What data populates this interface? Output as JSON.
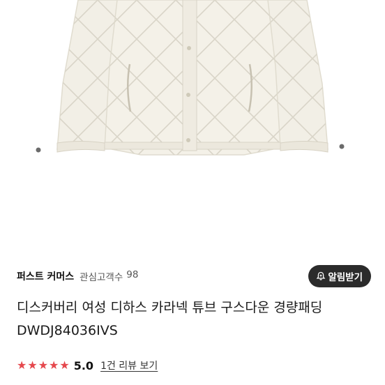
{
  "product_image": {
    "icon": "quilted-down-jacket-image",
    "color": "#efece2"
  },
  "store": {
    "name": "퍼스트 커머스",
    "followers_label": "관심고객수",
    "followers_count": "98"
  },
  "alert_button": {
    "icon": "bell-plus-icon",
    "label": "알림받기"
  },
  "product": {
    "title": "디스커버리 여성 디하스 카라넥 튜브 구스다운 경량패딩 DWDJ84036IVS"
  },
  "rating": {
    "stars": 5,
    "star_color": "#e5484d",
    "score": "5.0",
    "review_link": "1건 리뷰 보기"
  }
}
